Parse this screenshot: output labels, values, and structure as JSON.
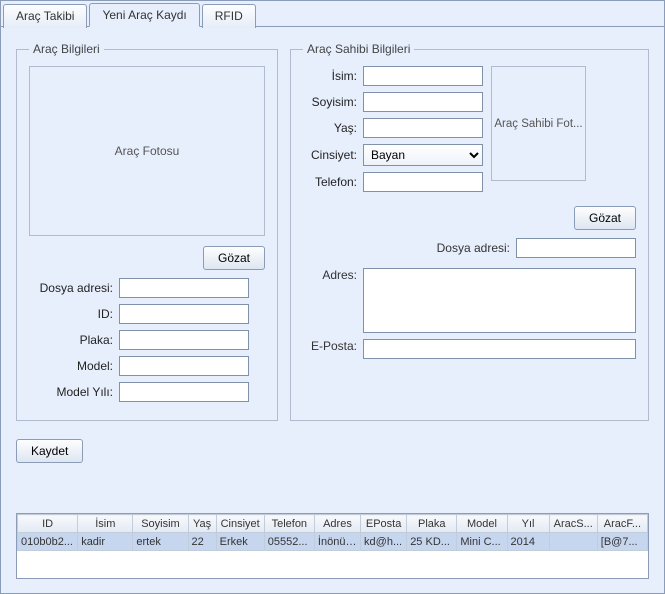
{
  "tabs": [
    "Araç Takibi",
    "Yeni Araç Kaydı",
    "RFID"
  ],
  "vehicle": {
    "legend": "Araç Bilgileri",
    "photoLabel": "Araç Fotosu",
    "browse": "Gözat",
    "filePathLabel": "Dosya adresi:",
    "filePath": "",
    "idLabel": "ID:",
    "id": "",
    "plateLabel": "Plaka:",
    "plate": "",
    "modelLabel": "Model:",
    "model": "",
    "yearLabel": "Model Yılı:",
    "year": ""
  },
  "owner": {
    "legend": "Araç Sahibi Bilgileri",
    "nameLabel": "İsim:",
    "name": "",
    "surnameLabel": "Soyisim:",
    "surname": "",
    "ageLabel": "Yaş:",
    "age": "",
    "genderLabel": "Cinsiyet:",
    "gender": "Bayan",
    "phoneLabel": "Telefon:",
    "phone": "",
    "photoLabel": "Araç Sahibi Fot...",
    "browse": "Gözat",
    "filePathLabel": "Dosya adresi:",
    "filePath": "",
    "addressLabel": "Adres:",
    "address": "",
    "emailLabel": "E-Posta:",
    "email": ""
  },
  "save": "Kaydet",
  "grid": {
    "headers": [
      "ID",
      "İsim",
      "Soyisim",
      "Yaş",
      "Cinsiyet",
      "Telefon",
      "Adres",
      "EPosta",
      "Plaka",
      "Model",
      "Yıl",
      "AracS...",
      "AracF..."
    ],
    "row": [
      "010b0b2...",
      "kadir",
      "ertek",
      "22",
      "Erkek",
      "05552...",
      "İnönü ...",
      "kd@h...",
      "25 KD...",
      "Mini C...",
      "2014",
      "",
      "[B@7..."
    ]
  }
}
